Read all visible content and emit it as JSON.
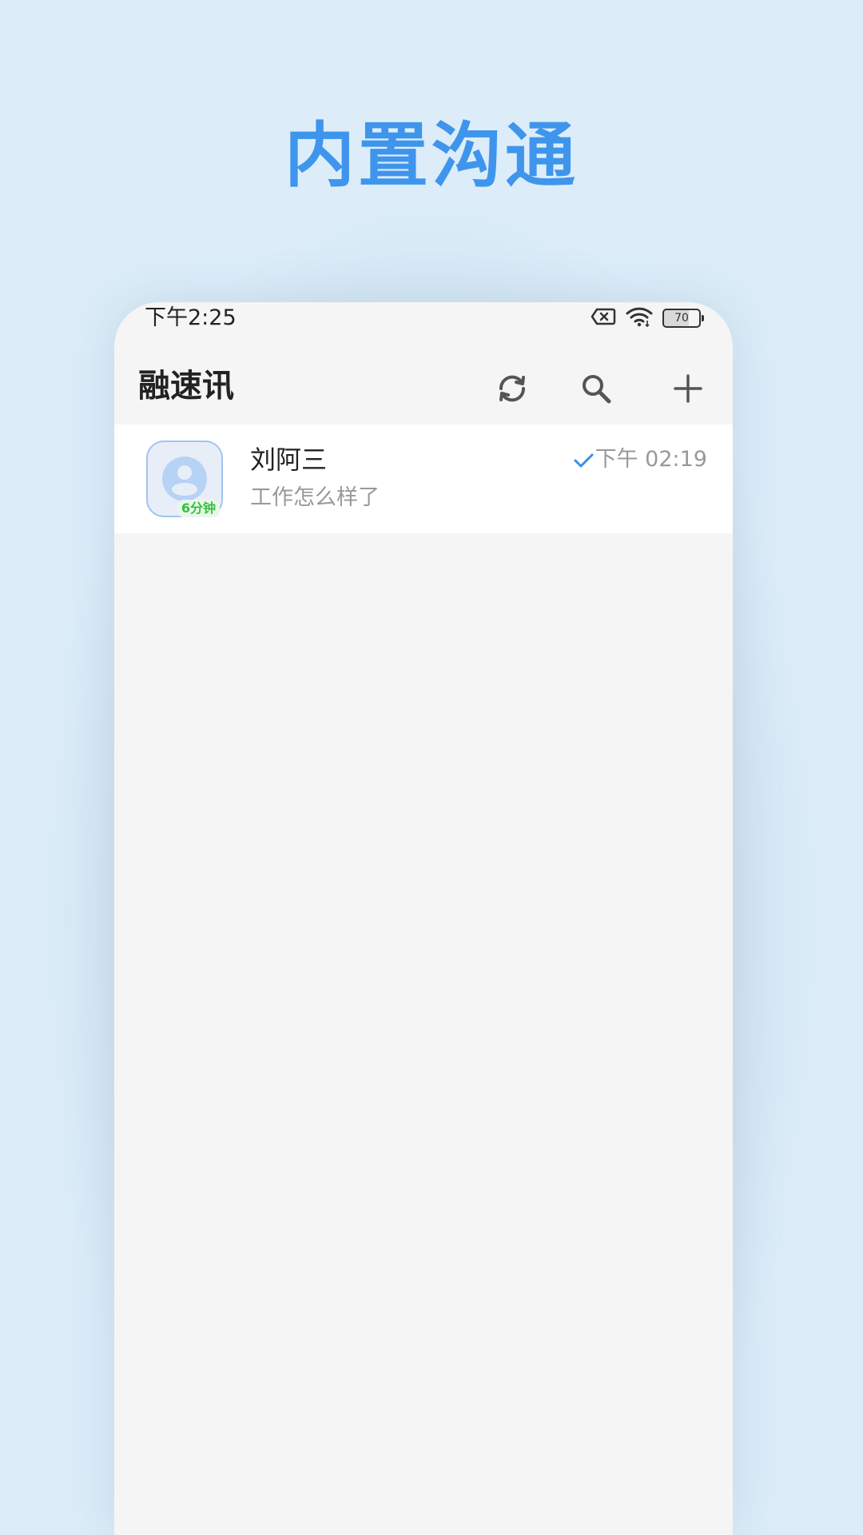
{
  "headline": "内置沟通",
  "status_bar": {
    "time": "下午2:25",
    "battery_level": "70",
    "icons": [
      "sim-off-icon",
      "wifi-icon",
      "battery-icon"
    ]
  },
  "header": {
    "title": "融速讯",
    "actions": [
      "sync-icon",
      "search-icon",
      "add-icon"
    ]
  },
  "conversations": [
    {
      "name": "刘阿三",
      "preview": "工作怎么样了",
      "time": "下午 02:19",
      "badge": "6分钟",
      "status": "read-check-icon"
    }
  ],
  "colors": {
    "headline": "#3f95ec",
    "accent_check": "#3a8ee6",
    "badge_text": "#35c13f",
    "background": "#dcedf9",
    "list_background": "#f5f5f5"
  }
}
